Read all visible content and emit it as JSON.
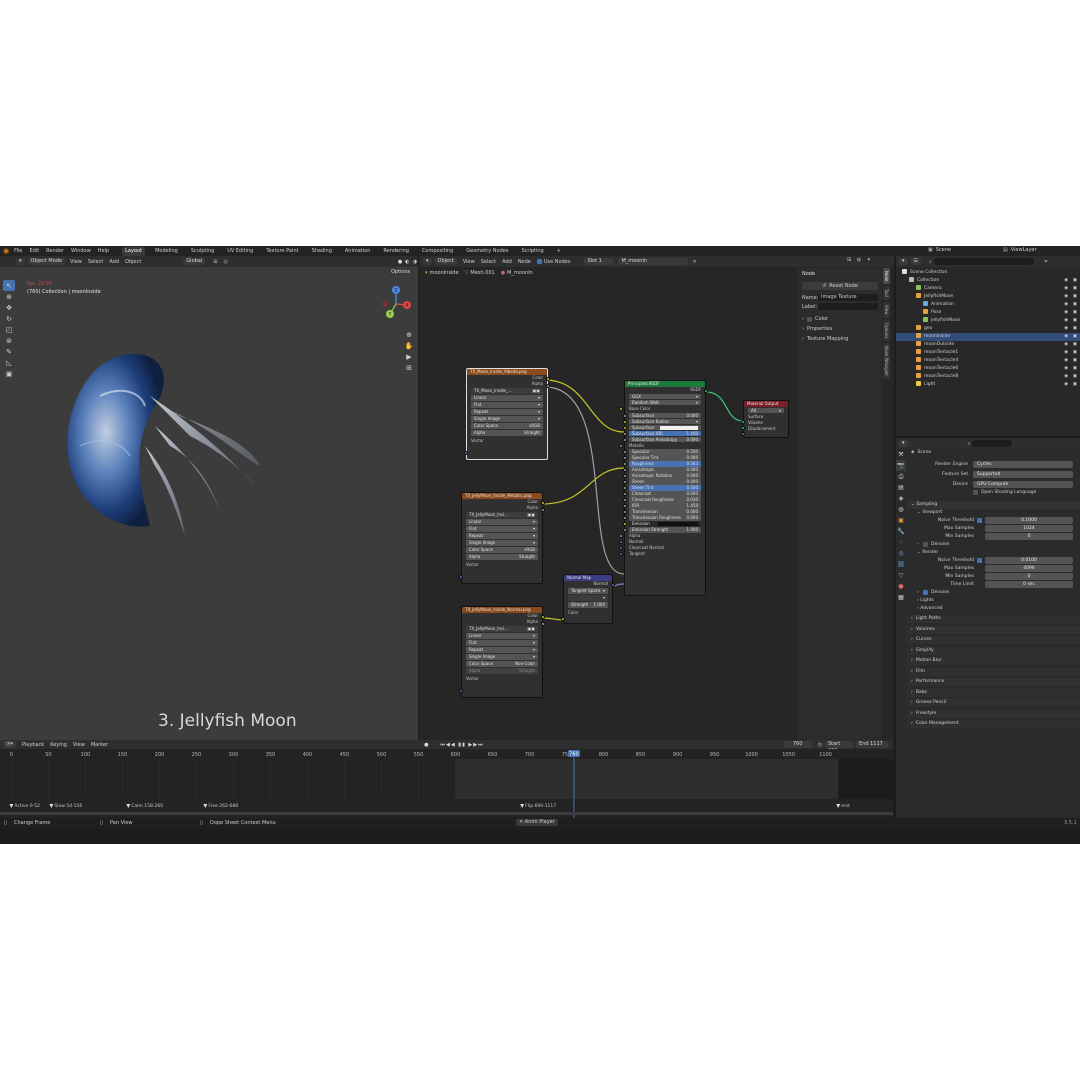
{
  "menubar": {
    "menus": [
      "File",
      "Edit",
      "Render",
      "Window",
      "Help"
    ],
    "workspaces": [
      "Layout",
      "Modeling",
      "Sculpting",
      "UV Editing",
      "Texture Paint",
      "Shading",
      "Animation",
      "Rendering",
      "Compositing",
      "Geometry Nodes",
      "Scripting"
    ],
    "active_workspace": "Layout",
    "add_tab": "+",
    "scene": "Scene",
    "view_layer": "ViewLayer"
  },
  "viewport": {
    "mode": "Object Mode",
    "menus": [
      "View",
      "Select",
      "Add",
      "Object"
    ],
    "transform": "Global",
    "options": "Options",
    "fps": "fps: 23.90",
    "collection": "(760) Collection | moonInside",
    "caption": "3. Jellyfish Moon",
    "gizmo_x": "X",
    "gizmo_y": "Y",
    "gizmo_z": "Z"
  },
  "node_editor": {
    "type": "Object",
    "menus": [
      "View",
      "Select",
      "Add",
      "Node"
    ],
    "use_nodes": "Use Nodes",
    "slot": "Slot 1",
    "material": "M_moonIn",
    "breadcrumbs": [
      "moonInside",
      "Mesh.001",
      "M_moonIn"
    ],
    "tex1": {
      "title": "TX_Moon_Inside_Albedo.png",
      "outputs": [
        "Color",
        "Alpha"
      ],
      "image": "TX_Moon_Inside_...",
      "fields": [
        "Linear",
        "Flat",
        "Repeat",
        "Single Image"
      ],
      "color_space_label": "Color Space",
      "color_space": "sRGB",
      "alpha_label": "Alpha",
      "alpha": "Straight",
      "vector": "Vector"
    },
    "tex2": {
      "title": "TX_JellyMoon_Inside_Metallic.png",
      "outputs": [
        "Color",
        "Alpha"
      ],
      "image": "TX_JellyMoon_Insi...",
      "fields": [
        "Linear",
        "Flat",
        "Repeat",
        "Single Image"
      ],
      "color_space_label": "Color Space",
      "color_space": "sRGB",
      "alpha_label": "Alpha",
      "alpha": "Straight",
      "vector": "Vector"
    },
    "tex3": {
      "title": "TX_JellyMoon_Inside_Normal.png",
      "outputs": [
        "Color",
        "Alpha"
      ],
      "image": "TX_JellyMoon_Insi...",
      "fields": [
        "Linear",
        "Flat",
        "Repeat",
        "Single Image"
      ],
      "color_space_label": "Color Space",
      "color_space": "Non-Color",
      "alpha_label": "Alpha",
      "alpha": "Straight",
      "vector": "Vector"
    },
    "normal_map": {
      "title": "Normal Map",
      "output": "Normal",
      "space": "Tangent Space",
      "uv": "",
      "strength_label": "Strength",
      "strength": "1.000",
      "input": "Color"
    },
    "bsdf": {
      "title": "Principled BSDF",
      "output": "BSDF",
      "dist": "GGX",
      "sss": "Random Walk",
      "rows": [
        {
          "label": "Base Color",
          "type": "plain"
        },
        {
          "label": "Subsurface",
          "value": "0.000",
          "type": "field"
        },
        {
          "label": "Subsurface Radius",
          "type": "dropdown"
        },
        {
          "label": "Subsurface C...",
          "type": "color"
        },
        {
          "label": "Subsurface IOR",
          "value": "1.400",
          "type": "blue"
        },
        {
          "label": "Subsurface Anisotropy",
          "value": "0.000",
          "type": "field"
        },
        {
          "label": "Metallic",
          "type": "plain"
        },
        {
          "label": "Specular",
          "value": "0.500",
          "type": "field"
        },
        {
          "label": "Specular Tint",
          "value": "0.000",
          "type": "field"
        },
        {
          "label": "Roughness",
          "value": "0.563",
          "type": "blue"
        },
        {
          "label": "Anisotropic",
          "value": "0.000",
          "type": "field"
        },
        {
          "label": "Anisotropic Rotation",
          "value": "0.000",
          "type": "field"
        },
        {
          "label": "Sheen",
          "value": "0.000",
          "type": "field"
        },
        {
          "label": "Sheen Tint",
          "value": "0.500",
          "type": "blue"
        },
        {
          "label": "Clearcoat",
          "value": "0.000",
          "type": "field"
        },
        {
          "label": "Clearcoat Roughness",
          "value": "0.030",
          "type": "field"
        },
        {
          "label": "IOR",
          "value": "1.450",
          "type": "field"
        },
        {
          "label": "Transmission",
          "value": "0.000",
          "type": "field"
        },
        {
          "label": "Transmission Roughness",
          "value": "0.000",
          "type": "field"
        },
        {
          "label": "Emission",
          "type": "dark"
        },
        {
          "label": "Emission Strength",
          "value": "1.000",
          "type": "field"
        },
        {
          "label": "Alpha",
          "type": "plain"
        },
        {
          "label": "Normal",
          "type": "plain"
        },
        {
          "label": "Clearcoat Normal",
          "type": "plain"
        },
        {
          "label": "Tangent",
          "type": "plain"
        }
      ]
    },
    "output": {
      "title": "Material Output",
      "target": "All",
      "inputs": [
        "Surface",
        "Volume",
        "Displacement"
      ]
    },
    "sidebar": {
      "title": "Node",
      "reset": "Reset Node",
      "name_label": "Name:",
      "name": "Image Texture",
      "label_label": "Label:",
      "color": "Color",
      "properties": "Properties",
      "texture_mapping": "Texture Mapping",
      "tabs": [
        "Node",
        "Tool",
        "View",
        "Options",
        "Node Wrangler"
      ]
    }
  },
  "outliner": {
    "items": [
      {
        "label": "Scene Collection",
        "indent": 0
      },
      {
        "label": "Collection",
        "indent": 1
      },
      {
        "label": "Camera",
        "indent": 2
      },
      {
        "label": "JellyfishMoon",
        "indent": 2
      },
      {
        "label": "Animation",
        "indent": 3
      },
      {
        "label": "Pose",
        "indent": 3
      },
      {
        "label": "jellyfishMoon",
        "indent": 3
      },
      {
        "label": "geo",
        "indent": 2
      },
      {
        "label": "moonInside",
        "indent": 2
      },
      {
        "label": "moonOutside",
        "indent": 2
      },
      {
        "label": "moonTentacle1",
        "indent": 2
      },
      {
        "label": "moonTentacle4",
        "indent": 2
      },
      {
        "label": "moonTentacle6",
        "indent": 2
      },
      {
        "label": "moonTentacle8",
        "indent": 2
      },
      {
        "label": "Light",
        "indent": 2
      }
    ]
  },
  "properties": {
    "scene": "Scene",
    "render_engine_label": "Render Engine",
    "render_engine": "Cycles",
    "feature_set_label": "Feature Set",
    "feature_set": "Supported",
    "device_label": "Device",
    "device": "GPU Compute",
    "osl": "Open Shading Language",
    "sampling": "Sampling",
    "viewport": "Viewport",
    "noise_threshold_label": "Noise Threshold",
    "vp_noise": "0.1000",
    "max_samples_label": "Max Samples",
    "vp_max": "1024",
    "min_samples_label": "Min Samples",
    "vp_min": "0",
    "denoise": "Denoise",
    "render": "Render",
    "r_noise": "0.0100",
    "r_max": "4096",
    "r_min": "0",
    "time_limit_label": "Time Limit",
    "r_time": "0 sec",
    "lights": "Lights",
    "advanced": "Advanced",
    "panels": [
      "Light Paths",
      "Volumes",
      "Curves",
      "Simplify",
      "Motion Blur",
      "Film",
      "Performance",
      "Bake",
      "Grease Pencil",
      "Freestyle",
      "Color Management"
    ]
  },
  "timeline": {
    "menus": [
      "Playback",
      "Keying",
      "View",
      "Marker"
    ],
    "current": "760",
    "start_label": "Start",
    "start": "600",
    "end_label": "End",
    "end": "1117",
    "ticks": [
      0,
      50,
      100,
      150,
      200,
      250,
      300,
      350,
      400,
      450,
      500,
      550,
      600,
      650,
      700,
      750,
      800,
      850,
      900,
      950,
      1000,
      1050,
      1100
    ],
    "frame_min": -10,
    "frame_max": 1160,
    "markers": [
      {
        "label": "Active 0-52",
        "frame": 0
      },
      {
        "label": "Slow 54-156",
        "frame": 54
      },
      {
        "label": "Calm 158-260",
        "frame": 158
      },
      {
        "label": "Free 262-688",
        "frame": 262
      },
      {
        "label": "Flip 690-1117",
        "frame": 690
      },
      {
        "label": "end",
        "frame": 1117
      }
    ]
  },
  "status": {
    "items": [
      "Change Frame",
      "Pan View",
      "Dope Sheet Context Menu"
    ],
    "center": "Anim Player",
    "version": "3.5.1"
  }
}
